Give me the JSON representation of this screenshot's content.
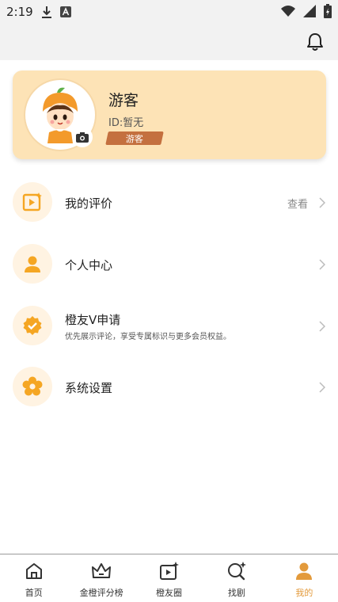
{
  "status_bar": {
    "time": "2:19",
    "download_icon": "download-icon",
    "notification_icon": "a-badge-icon",
    "wifi_icon": "wifi-icon",
    "signal_icon": "signal-icon",
    "battery_icon": "battery-charging-icon"
  },
  "header": {
    "bell_icon": "bell-icon"
  },
  "profile": {
    "name": "游客",
    "id_text": "ID:暂无",
    "tag": "游客",
    "avatar_icon": "orange-mascot-avatar",
    "camera_icon": "camera-icon"
  },
  "menu": [
    {
      "label": "我的评价",
      "icon": "review-icon",
      "trailing": "查看"
    },
    {
      "label": "个人中心",
      "icon": "user-icon"
    },
    {
      "label": "橙友V申请",
      "icon": "verified-badge-icon",
      "subtitle": "优先展示评论，享受专属标识与更多会员权益。"
    },
    {
      "label": "系统设置",
      "icon": "settings-icon"
    }
  ],
  "tabs": [
    {
      "label": "首页",
      "icon": "home-icon",
      "active": false
    },
    {
      "label": "金橙评分榜",
      "icon": "crown-icon",
      "active": false
    },
    {
      "label": "橙友圈",
      "icon": "video-sparkle-icon",
      "active": false
    },
    {
      "label": "找剧",
      "icon": "search-sparkle-icon",
      "active": false
    },
    {
      "label": "我的",
      "icon": "person-icon",
      "active": true
    }
  ],
  "colors": {
    "accent": "#e39a3b",
    "icon_orange": "#f5a623",
    "card_bg": "#fde3b6",
    "tag_bg": "#c4703f"
  }
}
